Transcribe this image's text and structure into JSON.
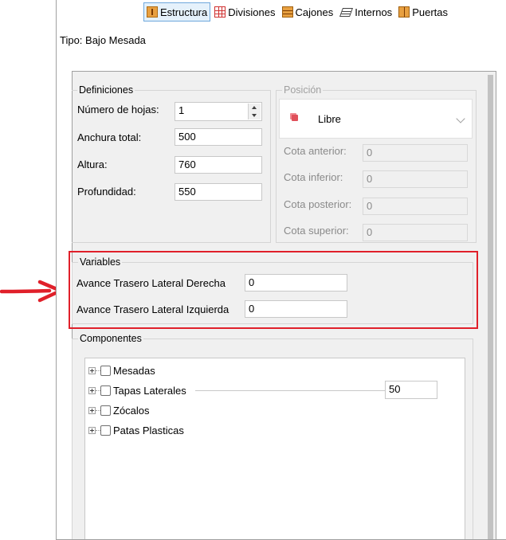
{
  "toolbar": {
    "tabs": [
      {
        "label": "Estructura",
        "icon": "structure-icon",
        "active": true
      },
      {
        "label": "Divisiones",
        "icon": "grid-icon"
      },
      {
        "label": "Cajones",
        "icon": "drawers-icon"
      },
      {
        "label": "Internos",
        "icon": "internals-icon"
      },
      {
        "label": "Puertas",
        "icon": "doors-icon"
      }
    ]
  },
  "tipo": "Tipo: Bajo Mesada",
  "definiciones": {
    "title": "Definiciones",
    "numero_hojas_label": "Número de hojas:",
    "numero_hojas_value": "1",
    "anchura_label": "Anchura total:",
    "anchura_value": "500",
    "altura_label": "Altura:",
    "altura_value": "760",
    "profundidad_label": "Profundidad:",
    "profundidad_value": "550"
  },
  "posicion": {
    "title": "Posición",
    "selected": "Libre",
    "cota_anterior_label": "Cota anterior:",
    "cota_anterior_value": "0",
    "cota_inferior_label": "Cota inferior:",
    "cota_inferior_value": "0",
    "cota_posterior_label": "Cota posterior:",
    "cota_posterior_value": "0",
    "cota_superior_label": "Cota superior:",
    "cota_superior_value": "0"
  },
  "variables": {
    "title": "Variables",
    "items": [
      {
        "label": "Avance Trasero Lateral Derecha",
        "value": "0"
      },
      {
        "label": "Avance Trasero Lateral Izquierda",
        "value": "0"
      }
    ]
  },
  "componentes": {
    "title": "Componentes",
    "items": [
      {
        "label": "Mesadas"
      },
      {
        "label": "Tapas Laterales",
        "value": "50"
      },
      {
        "label": "Zócalos"
      },
      {
        "label": "Patas Plasticas"
      }
    ]
  },
  "colors": {
    "highlight": "#e0202a",
    "arrow": "#e0202a"
  }
}
